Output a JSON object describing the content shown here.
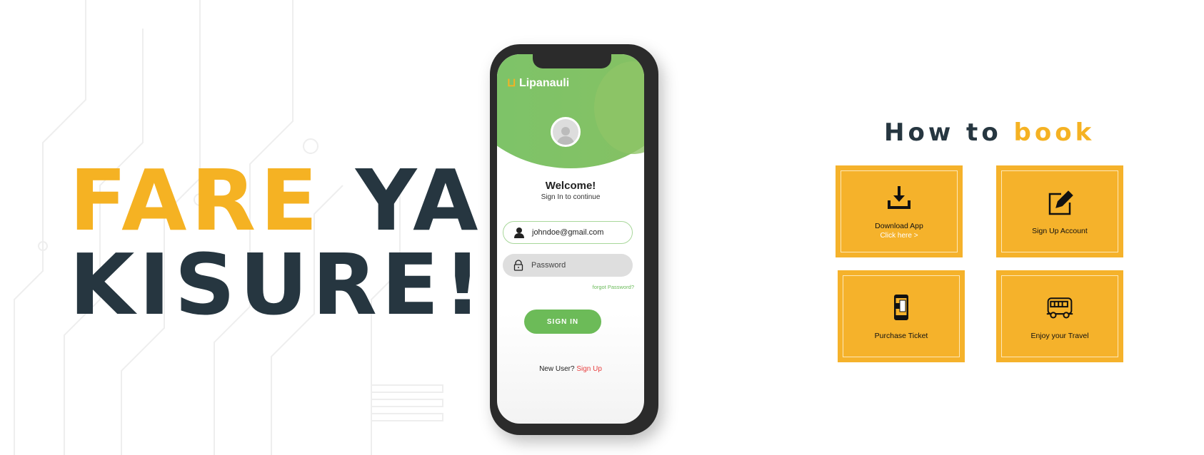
{
  "hero": {
    "line1_accent": "FARE",
    "line1_rest": "YA",
    "line2": "KISURE!"
  },
  "colors": {
    "accent": "#f5b223",
    "dark": "#263640",
    "green": "#6cbb58"
  },
  "app": {
    "logo": "Lipanauli",
    "welcome": "Welcome!",
    "subtitle": "Sign In to continue",
    "email_value": "johndoe@gmail.com",
    "password_placeholder": "Password",
    "forgot": "forgot Password?",
    "signin": "SIGN IN",
    "new_user": "New User?",
    "sign_up": "Sign Up"
  },
  "how": {
    "title_a": "How to",
    "title_b": "book",
    "steps": [
      {
        "label": "Download App",
        "link": "Click here >",
        "icon": "download-icon"
      },
      {
        "label": "Sign Up Account",
        "icon": "edit-icon"
      },
      {
        "label": "Purchase Ticket",
        "icon": "mobile-ticket-icon"
      },
      {
        "label": "Enjoy your Travel",
        "icon": "bus-icon"
      }
    ]
  }
}
